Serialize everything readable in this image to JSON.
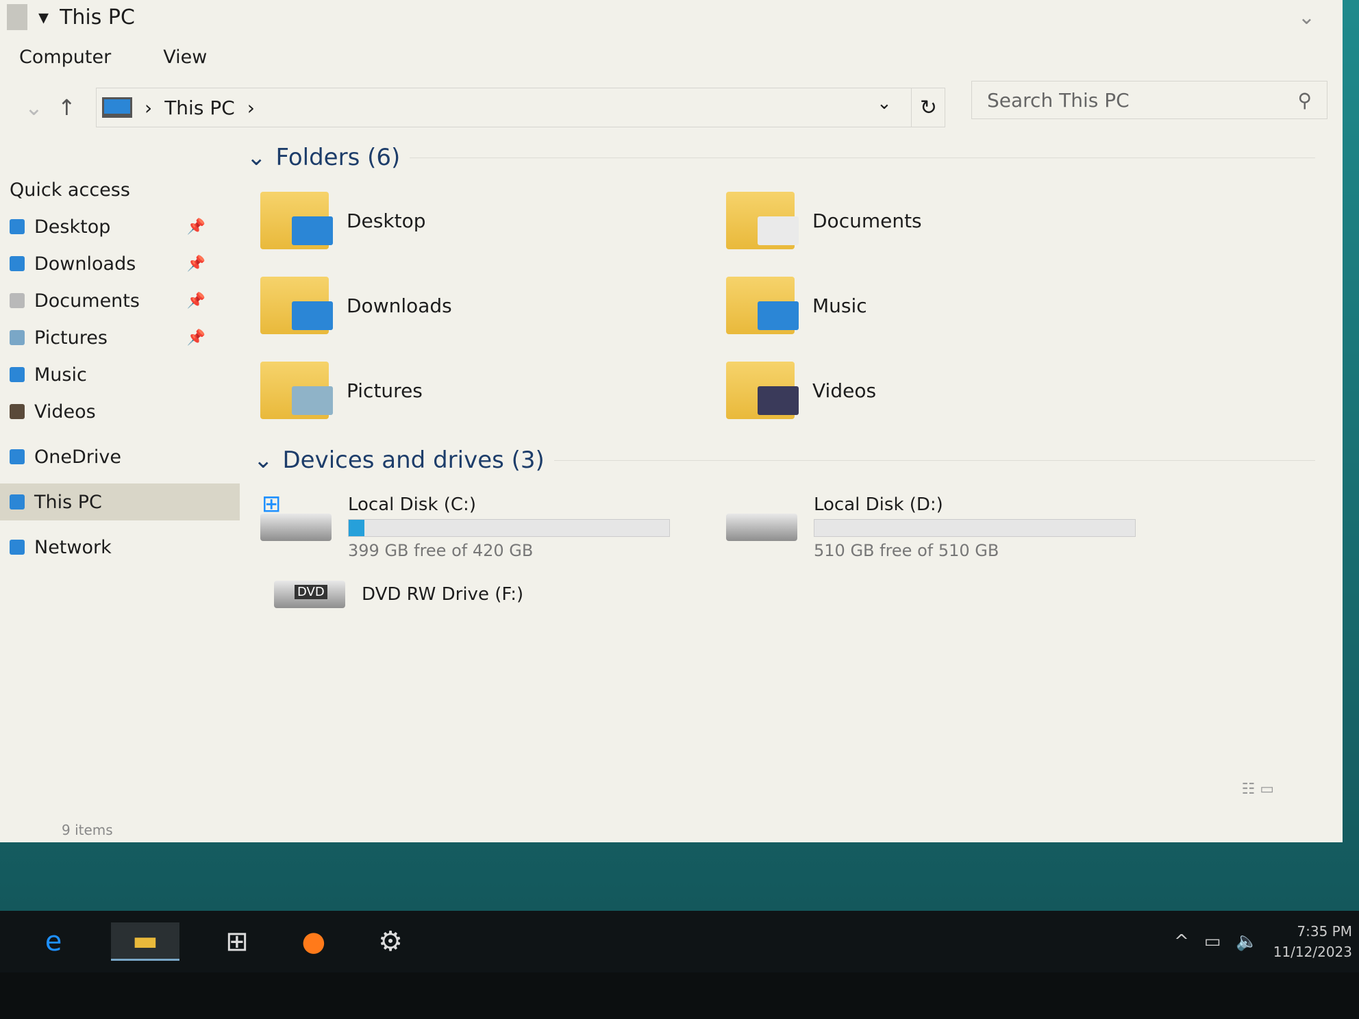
{
  "window": {
    "title": "This PC"
  },
  "ribbon": {
    "tabs": [
      "Computer",
      "View"
    ]
  },
  "address": {
    "path": [
      "This PC"
    ],
    "search_placeholder": "Search This PC"
  },
  "sidebar": {
    "items": [
      {
        "label": "Quick access",
        "icon": "star-icon",
        "pinned": false,
        "color": ""
      },
      {
        "label": "Desktop",
        "icon": "desktop-icon",
        "pinned": true,
        "color": "#2b86d6"
      },
      {
        "label": "Downloads",
        "icon": "download-icon",
        "pinned": true,
        "color": "#2b86d6"
      },
      {
        "label": "Documents",
        "icon": "document-icon",
        "pinned": true,
        "color": "#b9b9b9"
      },
      {
        "label": "Pictures",
        "icon": "picture-icon",
        "pinned": true,
        "color": "#7aa7c7"
      },
      {
        "label": "Music",
        "icon": "music-icon",
        "pinned": false,
        "color": "#2b86d6"
      },
      {
        "label": "Videos",
        "icon": "video-icon",
        "pinned": false,
        "color": "#5a4a3a"
      },
      {
        "label": "OneDrive",
        "icon": "cloud-icon",
        "pinned": false,
        "color": "#2b86d6"
      },
      {
        "label": "This PC",
        "icon": "computer-icon",
        "pinned": false,
        "color": "#2b86d6",
        "selected": true
      },
      {
        "label": "Network",
        "icon": "network-icon",
        "pinned": false,
        "color": "#2b86d6"
      }
    ]
  },
  "folders": {
    "header": "Folders (6)",
    "items": [
      {
        "label": "Desktop",
        "icon": "desktop-folder-icon",
        "color": "#2b86d6"
      },
      {
        "label": "Documents",
        "icon": "documents-folder-icon",
        "color": "#eaeaea"
      },
      {
        "label": "Downloads",
        "icon": "downloads-folder-icon",
        "color": "#2b86d6"
      },
      {
        "label": "Music",
        "icon": "music-folder-icon",
        "color": "#2b86d6"
      },
      {
        "label": "Pictures",
        "icon": "pictures-folder-icon",
        "color": "#8fb3c8"
      },
      {
        "label": "Videos",
        "icon": "videos-folder-icon",
        "color": "#3a3a5a"
      }
    ]
  },
  "drives": {
    "header": "Devices and drives (3)",
    "items": [
      {
        "label": "Local Disk (C:)",
        "free": "399 GB free of 420 GB",
        "used_percent": 5
      },
      {
        "label": "Local Disk (D:)",
        "free": "510 GB free of 510 GB",
        "used_percent": 0
      },
      {
        "label": "DVD RW Drive (F:)"
      }
    ]
  },
  "status": {
    "count": "9 items"
  },
  "taskbar": {
    "clock_time": "7:35 PM",
    "clock_date": "11/12/2023"
  }
}
